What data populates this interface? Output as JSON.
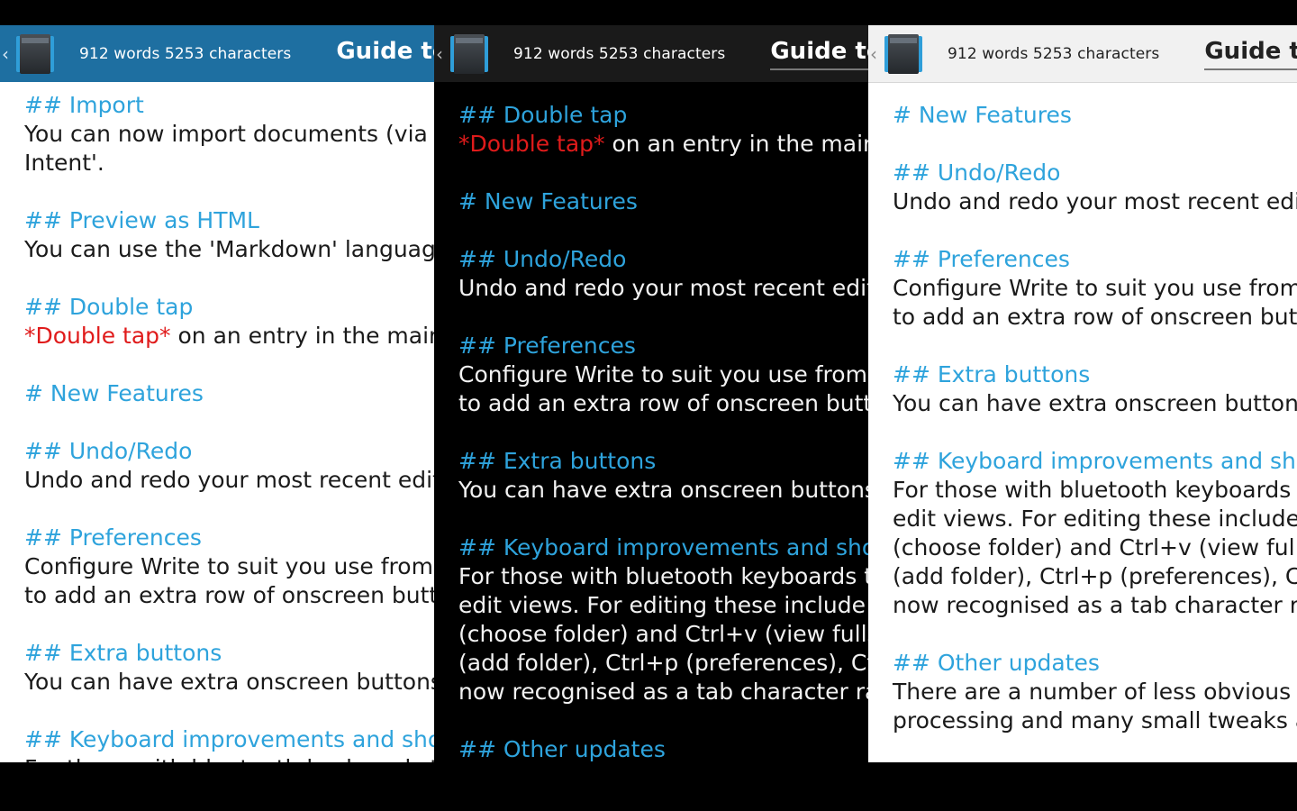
{
  "header": {
    "counts": "912 words 5253 characters",
    "tab_title": "Guide to Write"
  },
  "icons": {
    "up": "chevron-left-icon",
    "app": "notebook-icon"
  },
  "colors": {
    "heading": "#2ea3dc",
    "emphasis": "#e01b1b",
    "bar_blue": "#1e6fa1",
    "bar_dark": "#1a1a1a",
    "bar_light": "#f1f1f1"
  },
  "panel1": {
    "lines": [
      {
        "t": "h",
        "text": "## Import"
      },
      {
        "t": "p",
        "text": "You can now import documents (via s"
      },
      {
        "t": "p",
        "text": "Intent'."
      },
      {
        "t": "b"
      },
      {
        "t": "h",
        "text": "## Preview as HTML"
      },
      {
        "t": "p",
        "text": "You can use the 'Markdown' language"
      },
      {
        "t": "b"
      },
      {
        "t": "h",
        "text": "## Double tap"
      },
      {
        "t": "e",
        "em": "*Double tap*",
        "text": " on an entry in the main li"
      },
      {
        "t": "b"
      },
      {
        "t": "h",
        "text": "# New Features"
      },
      {
        "t": "b"
      },
      {
        "t": "h",
        "text": "## Undo/Redo"
      },
      {
        "t": "p",
        "text": "Undo and redo your most recent edits"
      },
      {
        "t": "b"
      },
      {
        "t": "h",
        "text": "## Preferences"
      },
      {
        "t": "p",
        "text": "Configure Write to suit you use from th"
      },
      {
        "t": "p",
        "text": "to add an extra row of onscreen button"
      },
      {
        "t": "b"
      },
      {
        "t": "h",
        "text": "## Extra buttons"
      },
      {
        "t": "p",
        "text": "You can have extra onscreen buttons t"
      },
      {
        "t": "b"
      },
      {
        "t": "h",
        "text": "## Keyboard improvements and short"
      },
      {
        "t": "p",
        "text": "For those with bluetooth keyboards th"
      }
    ]
  },
  "panel2": {
    "lines": [
      {
        "t": "h",
        "text": "## Double tap"
      },
      {
        "t": "e",
        "em": "*Double tap*",
        "text": " on an entry in the main li"
      },
      {
        "t": "b"
      },
      {
        "t": "h",
        "text": "# New Features"
      },
      {
        "t": "b"
      },
      {
        "t": "h",
        "text": "## Undo/Redo"
      },
      {
        "t": "p",
        "text": "Undo and redo your most recent edits"
      },
      {
        "t": "b"
      },
      {
        "t": "h",
        "text": "## Preferences"
      },
      {
        "t": "p",
        "text": "Configure Write to suit you use from th"
      },
      {
        "t": "p",
        "text": "to add an extra row of onscreen button"
      },
      {
        "t": "b"
      },
      {
        "t": "h",
        "text": "## Extra buttons"
      },
      {
        "t": "p",
        "text": "You can have extra onscreen buttons t"
      },
      {
        "t": "b"
      },
      {
        "t": "h",
        "text": "## Keyboard improvements and short"
      },
      {
        "t": "p",
        "text": "For those with bluetooth keyboards th"
      },
      {
        "t": "p",
        "text": "edit views. For editing these include C"
      },
      {
        "t": "p",
        "text": "(choose folder) and Ctrl+v (view fullsc"
      },
      {
        "t": "p",
        "text": "(add folder), Ctrl+p (preferences), Ctrl+"
      },
      {
        "t": "p",
        "text": "now recognised as a tab character rat"
      },
      {
        "t": "b"
      },
      {
        "t": "h",
        "text": "## Other updates"
      }
    ]
  },
  "panel3": {
    "lines": [
      {
        "t": "h",
        "text": "# New Features"
      },
      {
        "t": "b"
      },
      {
        "t": "h",
        "text": "## Undo/Redo"
      },
      {
        "t": "p",
        "text": "Undo and redo your most recent edits"
      },
      {
        "t": "b"
      },
      {
        "t": "h",
        "text": "## Preferences"
      },
      {
        "t": "p",
        "text": "Configure Write to suit you use from th"
      },
      {
        "t": "p",
        "text": "to add an extra row of onscreen butto"
      },
      {
        "t": "b"
      },
      {
        "t": "h",
        "text": "## Extra buttons"
      },
      {
        "t": "p",
        "text": "You can have extra onscreen buttons"
      },
      {
        "t": "b"
      },
      {
        "t": "h",
        "text": "## Keyboard improvements and shor"
      },
      {
        "t": "p",
        "text": "For those with bluetooth keyboards th"
      },
      {
        "t": "p",
        "text": "edit views. For editing these include C"
      },
      {
        "t": "p",
        "text": "(choose folder) and Ctrl+v (view fullsc"
      },
      {
        "t": "p",
        "text": "(add folder), Ctrl+p (preferences), Ctrl-"
      },
      {
        "t": "p",
        "text": "now recognised as a tab character rat"
      },
      {
        "t": "b"
      },
      {
        "t": "h",
        "text": "## Other updates"
      },
      {
        "t": "p",
        "text": "There are a number of less obvious up"
      },
      {
        "t": "p",
        "text": "processing and many small tweaks ar"
      }
    ]
  }
}
